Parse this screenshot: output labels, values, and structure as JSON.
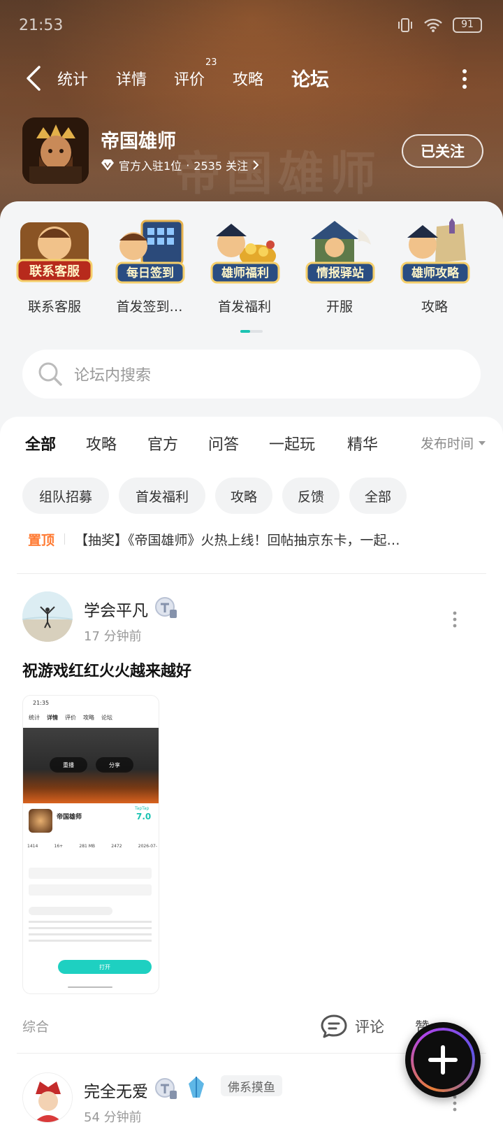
{
  "status_bar": {
    "time": "21:53",
    "battery": "91"
  },
  "nav": {
    "tabs": [
      {
        "label": "统计"
      },
      {
        "label": "详情"
      },
      {
        "label": "评价",
        "badge": "23"
      },
      {
        "label": "攻略"
      },
      {
        "label": "论坛",
        "active": true
      }
    ]
  },
  "game": {
    "title": "帝国雄师",
    "meta_official": "官方入驻1位",
    "meta_dot": "·",
    "meta_followers": "2535 关注",
    "follow_label": "已关注"
  },
  "shortcuts": [
    {
      "badge": "联系客服",
      "label": "联系客服"
    },
    {
      "badge": "每日签到",
      "label": "首发签到…"
    },
    {
      "badge": "雄师福利",
      "label": "首发福利"
    },
    {
      "badge": "情报驿站",
      "label": "开服"
    },
    {
      "badge": "雄师攻略",
      "label": "攻略"
    }
  ],
  "search": {
    "placeholder": "论坛内搜索"
  },
  "feed_tabs": [
    "全部",
    "攻略",
    "官方",
    "问答",
    "一起玩",
    "精华"
  ],
  "sort_label": "发布时间",
  "chips": [
    "组队招募",
    "首发福利",
    "攻略",
    "反馈",
    "全部"
  ],
  "pinned": {
    "tag": "置顶",
    "text": "【抽奖】《帝国雄师》火热上线！回帖抽京东卡，一起…"
  },
  "post": {
    "username": "学会平凡",
    "time": "17 分钟前",
    "title": "祝游戏红红火火越来越好",
    "category": "综合",
    "comment_label": "评论",
    "like_label": "赞",
    "screenshot": {
      "time": "21:35",
      "tabs": [
        "统计",
        "详情",
        "评价",
        "攻略",
        "论坛"
      ],
      "btn_reserve": "重播",
      "btn_share": "分享",
      "name": "帝国雄师",
      "score": "7.0",
      "score_label": "TapTap",
      "stats": [
        "1414",
        "16+",
        "281 MB",
        "2472",
        "2026-07-"
      ],
      "open_label": "打开"
    }
  },
  "post2": {
    "username": "完全无爱",
    "tag": "佛系摸鱼",
    "time": "54 分钟前"
  },
  "colors": {
    "accent": "#1ed0c1",
    "pin": "#ff7a32"
  }
}
